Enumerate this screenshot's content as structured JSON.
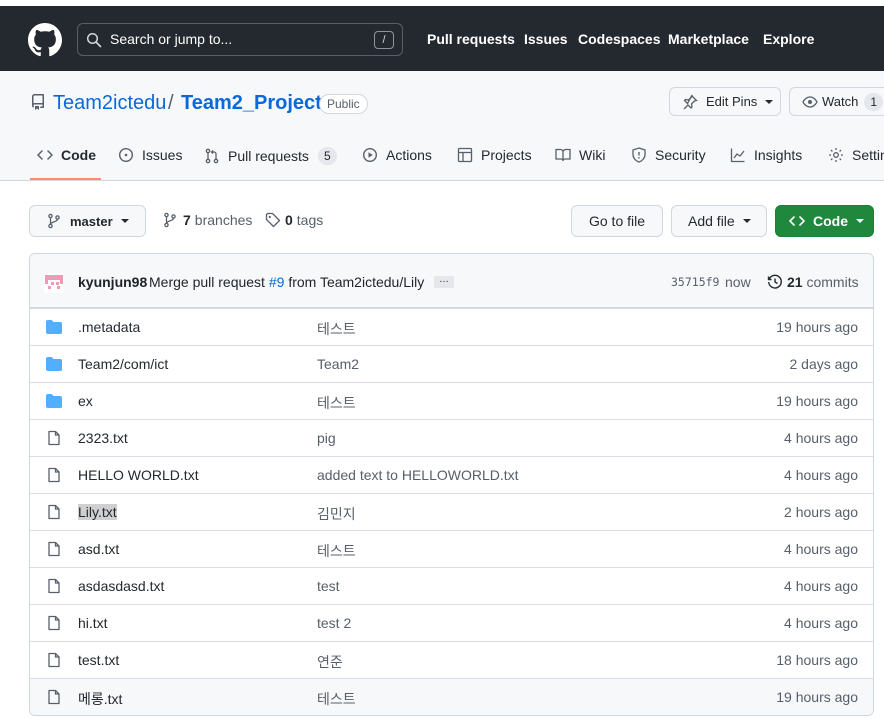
{
  "header": {
    "search_placeholder": "Search or jump to...",
    "search_shortcut": "/",
    "nav": [
      "Pull requests",
      "Issues",
      "Codespaces",
      "Marketplace",
      "Explore"
    ]
  },
  "repo": {
    "owner": "Team2ictedu",
    "separator": "/",
    "name": "Team2_Project",
    "visibility": "Public",
    "edit_pins": "Edit Pins",
    "watch_label": "Watch",
    "watch_count": "1"
  },
  "tabs": [
    {
      "label": "Code",
      "icon": "code-icon"
    },
    {
      "label": "Issues",
      "icon": "issue-icon"
    },
    {
      "label": "Pull requests",
      "icon": "pull-request-icon",
      "count": "5"
    },
    {
      "label": "Actions",
      "icon": "play-icon"
    },
    {
      "label": "Projects",
      "icon": "table-icon"
    },
    {
      "label": "Wiki",
      "icon": "book-icon"
    },
    {
      "label": "Security",
      "icon": "shield-icon"
    },
    {
      "label": "Insights",
      "icon": "graph-icon"
    },
    {
      "label": "Settin",
      "icon": "gear-icon"
    }
  ],
  "branch": {
    "current": "master",
    "branches_count": "7",
    "branches_label": "branches",
    "tags_count": "0",
    "tags_label": "tags",
    "go_to_file": "Go to file",
    "add_file": "Add file",
    "code_button": "Code"
  },
  "commit": {
    "author": "kyunjun98",
    "message_prefix": "Merge pull request",
    "pr_link": "#9",
    "message_suffix": "from Team2ictedu/Lily",
    "ellipsis": "…",
    "sha": "35715f9",
    "time": "now",
    "commits_count": "21",
    "commits_label": "commits"
  },
  "files": [
    {
      "type": "folder",
      "name": ".metadata",
      "message": "테스트",
      "age": "19 hours ago"
    },
    {
      "type": "folder",
      "name": "Team2/com/ict",
      "message": "Team2",
      "age": "2 days ago"
    },
    {
      "type": "folder",
      "name": "ex",
      "message": "테스트",
      "age": "19 hours ago"
    },
    {
      "type": "file",
      "name": "2323.txt",
      "message": "pig",
      "age": "4 hours ago"
    },
    {
      "type": "file",
      "name": "HELLO WORLD.txt",
      "message": "added text to HELLOWORLD.txt",
      "age": "4 hours ago"
    },
    {
      "type": "file",
      "name": "Lily.txt",
      "message": "김민지",
      "age": "2 hours ago"
    },
    {
      "type": "file",
      "name": "asd.txt",
      "message": "테스트",
      "age": "4 hours ago"
    },
    {
      "type": "file",
      "name": "asdasdasd.txt",
      "message": "test",
      "age": "4 hours ago"
    },
    {
      "type": "file",
      "name": "hi.txt",
      "message": "test 2",
      "age": "4 hours ago"
    },
    {
      "type": "file",
      "name": "test.txt",
      "message": "연준",
      "age": "18 hours ago"
    },
    {
      "type": "file",
      "name": "메롱.txt",
      "message": "테스트",
      "age": "19 hours ago"
    }
  ],
  "colors": {
    "header_bg": "#24292f",
    "link": "#0969da",
    "primary_button": "#1f883d",
    "folder": "#54aeff",
    "tab_underline": "#fd8c73"
  }
}
